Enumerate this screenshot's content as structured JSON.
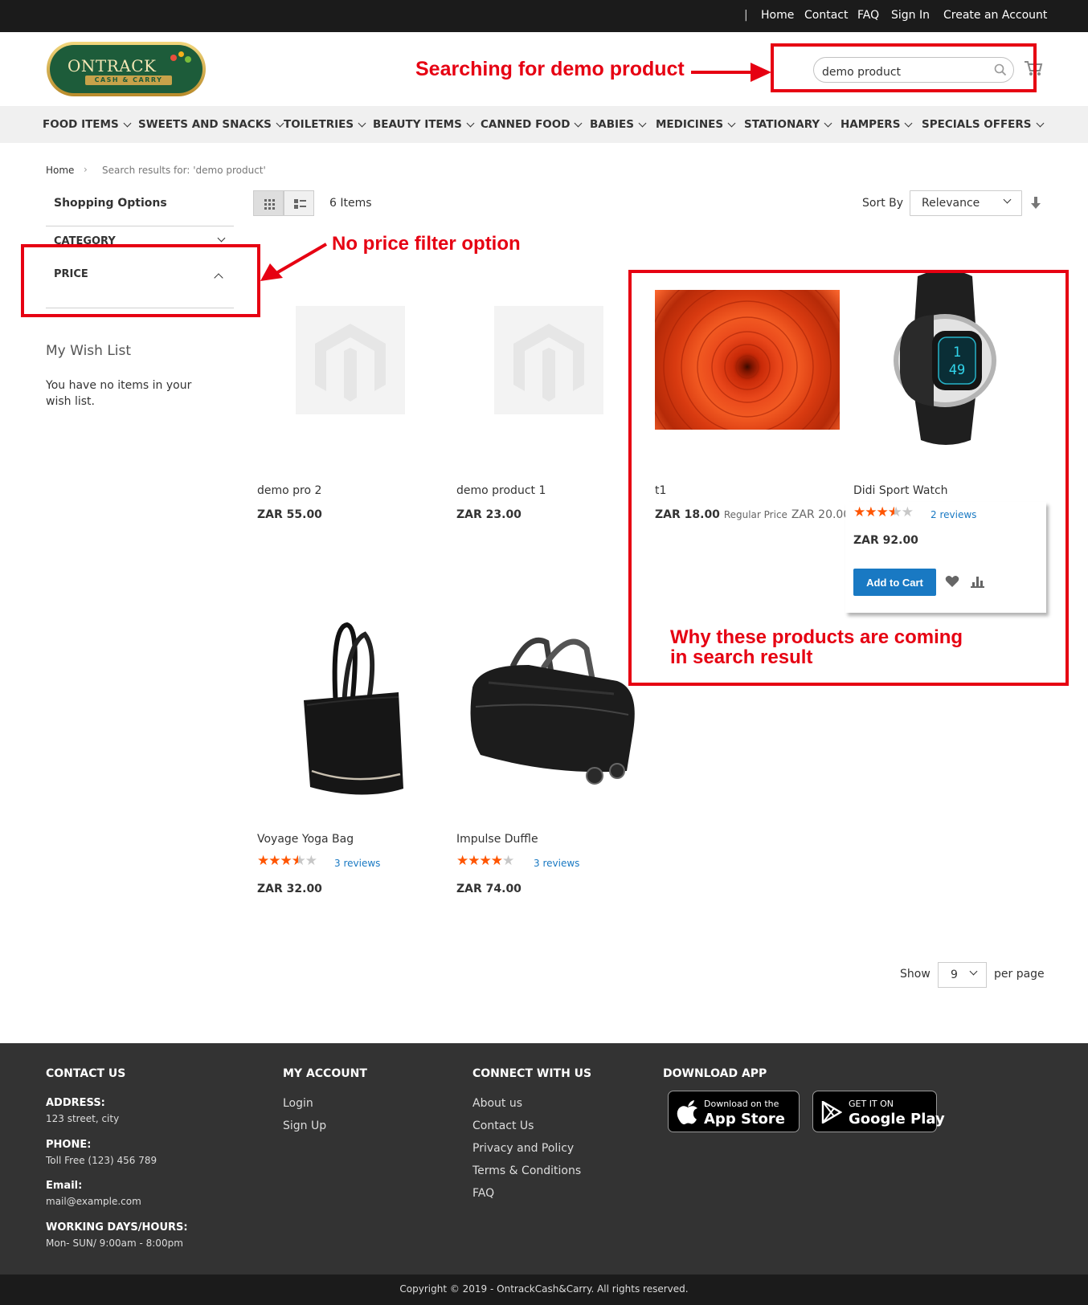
{
  "topbar": {
    "links": [
      "Home",
      "Contact",
      "FAQ",
      "Sign In",
      "Create an Account"
    ]
  },
  "logo": {
    "main": "ONTRACK",
    "sub": "CASH & CARRY"
  },
  "search": {
    "value": "demo product"
  },
  "nav": {
    "items": [
      "FOOD ITEMS",
      "SWEETS AND SNACKS",
      "TOILETRIES",
      "BEAUTY ITEMS",
      "CANNED FOOD",
      "BABIES",
      "MEDICINES",
      "STATIONARY",
      "HAMPERS",
      "SPECIALS OFFERS"
    ]
  },
  "breadcrumb": {
    "home": "Home",
    "current": "Search results for: 'demo product'"
  },
  "sidebar": {
    "title": "Shopping Options",
    "filters": [
      "CATEGORY",
      "PRICE"
    ],
    "wishlist_title": "My Wish List",
    "wishlist_empty": "You have no items in your wish list."
  },
  "toolbar": {
    "count": "6 Items",
    "sort_label": "Sort By",
    "sort_value": "Relevance",
    "show_label": "Show",
    "limit": "9",
    "per_page": "per page"
  },
  "products": [
    {
      "name": "demo pro 2",
      "price": "ZAR 55.00"
    },
    {
      "name": "demo product 1",
      "price": "ZAR 23.00"
    },
    {
      "name": "t1",
      "price": "ZAR 18.00",
      "regular_label": "Regular Price",
      "regular_price": "ZAR 20.00"
    },
    {
      "name": "Didi Sport Watch",
      "price": "ZAR 92.00",
      "rating": 3.5,
      "reviews": "2 reviews",
      "add_to_cart": "Add to Cart"
    },
    {
      "name": "Voyage Yoga Bag",
      "price": "ZAR 32.00",
      "rating": 3.5,
      "reviews": "3 reviews"
    },
    {
      "name": "Impulse Duffle",
      "price": "ZAR 74.00",
      "rating": 4,
      "reviews": "3 reviews"
    }
  ],
  "annotations": {
    "search": "Searching for demo product",
    "price": "No price filter option",
    "results_line1": "Why these products are coming",
    "results_line2": "in search result"
  },
  "footer": {
    "contact_title": "CONTACT US",
    "address_label": "ADDRESS:",
    "address": "123 street, city",
    "phone_label": "PHONE:",
    "phone": "Toll Free (123) 456 789",
    "email_label": "Email:",
    "email": "mail@example.com",
    "hours_label": "WORKING DAYS/HOURS:",
    "hours": "Mon- SUN/ 9:00am - 8:00pm",
    "account_title": "MY ACCOUNT",
    "account_links": [
      "Login",
      "Sign Up"
    ],
    "connect_title": "CONNECT WITH US",
    "connect_links": [
      "About us",
      "Contact Us",
      "Privacy and Policy",
      "Terms & Conditions",
      "FAQ"
    ],
    "app_title": "DOWNLOAD APP",
    "appstore_small": "Download on the",
    "appstore_big": "App Store",
    "play_small": "GET IT ON",
    "play_big": "Google Play",
    "copyright": "Copyright © 2019 - OntrackCash&Carry. All rights reserved."
  },
  "colors": {
    "annotation": "#e60012",
    "primary_button": "#1979c3",
    "star": "#ff5501",
    "topbar": "#1b1b1b",
    "footer": "#333333"
  }
}
